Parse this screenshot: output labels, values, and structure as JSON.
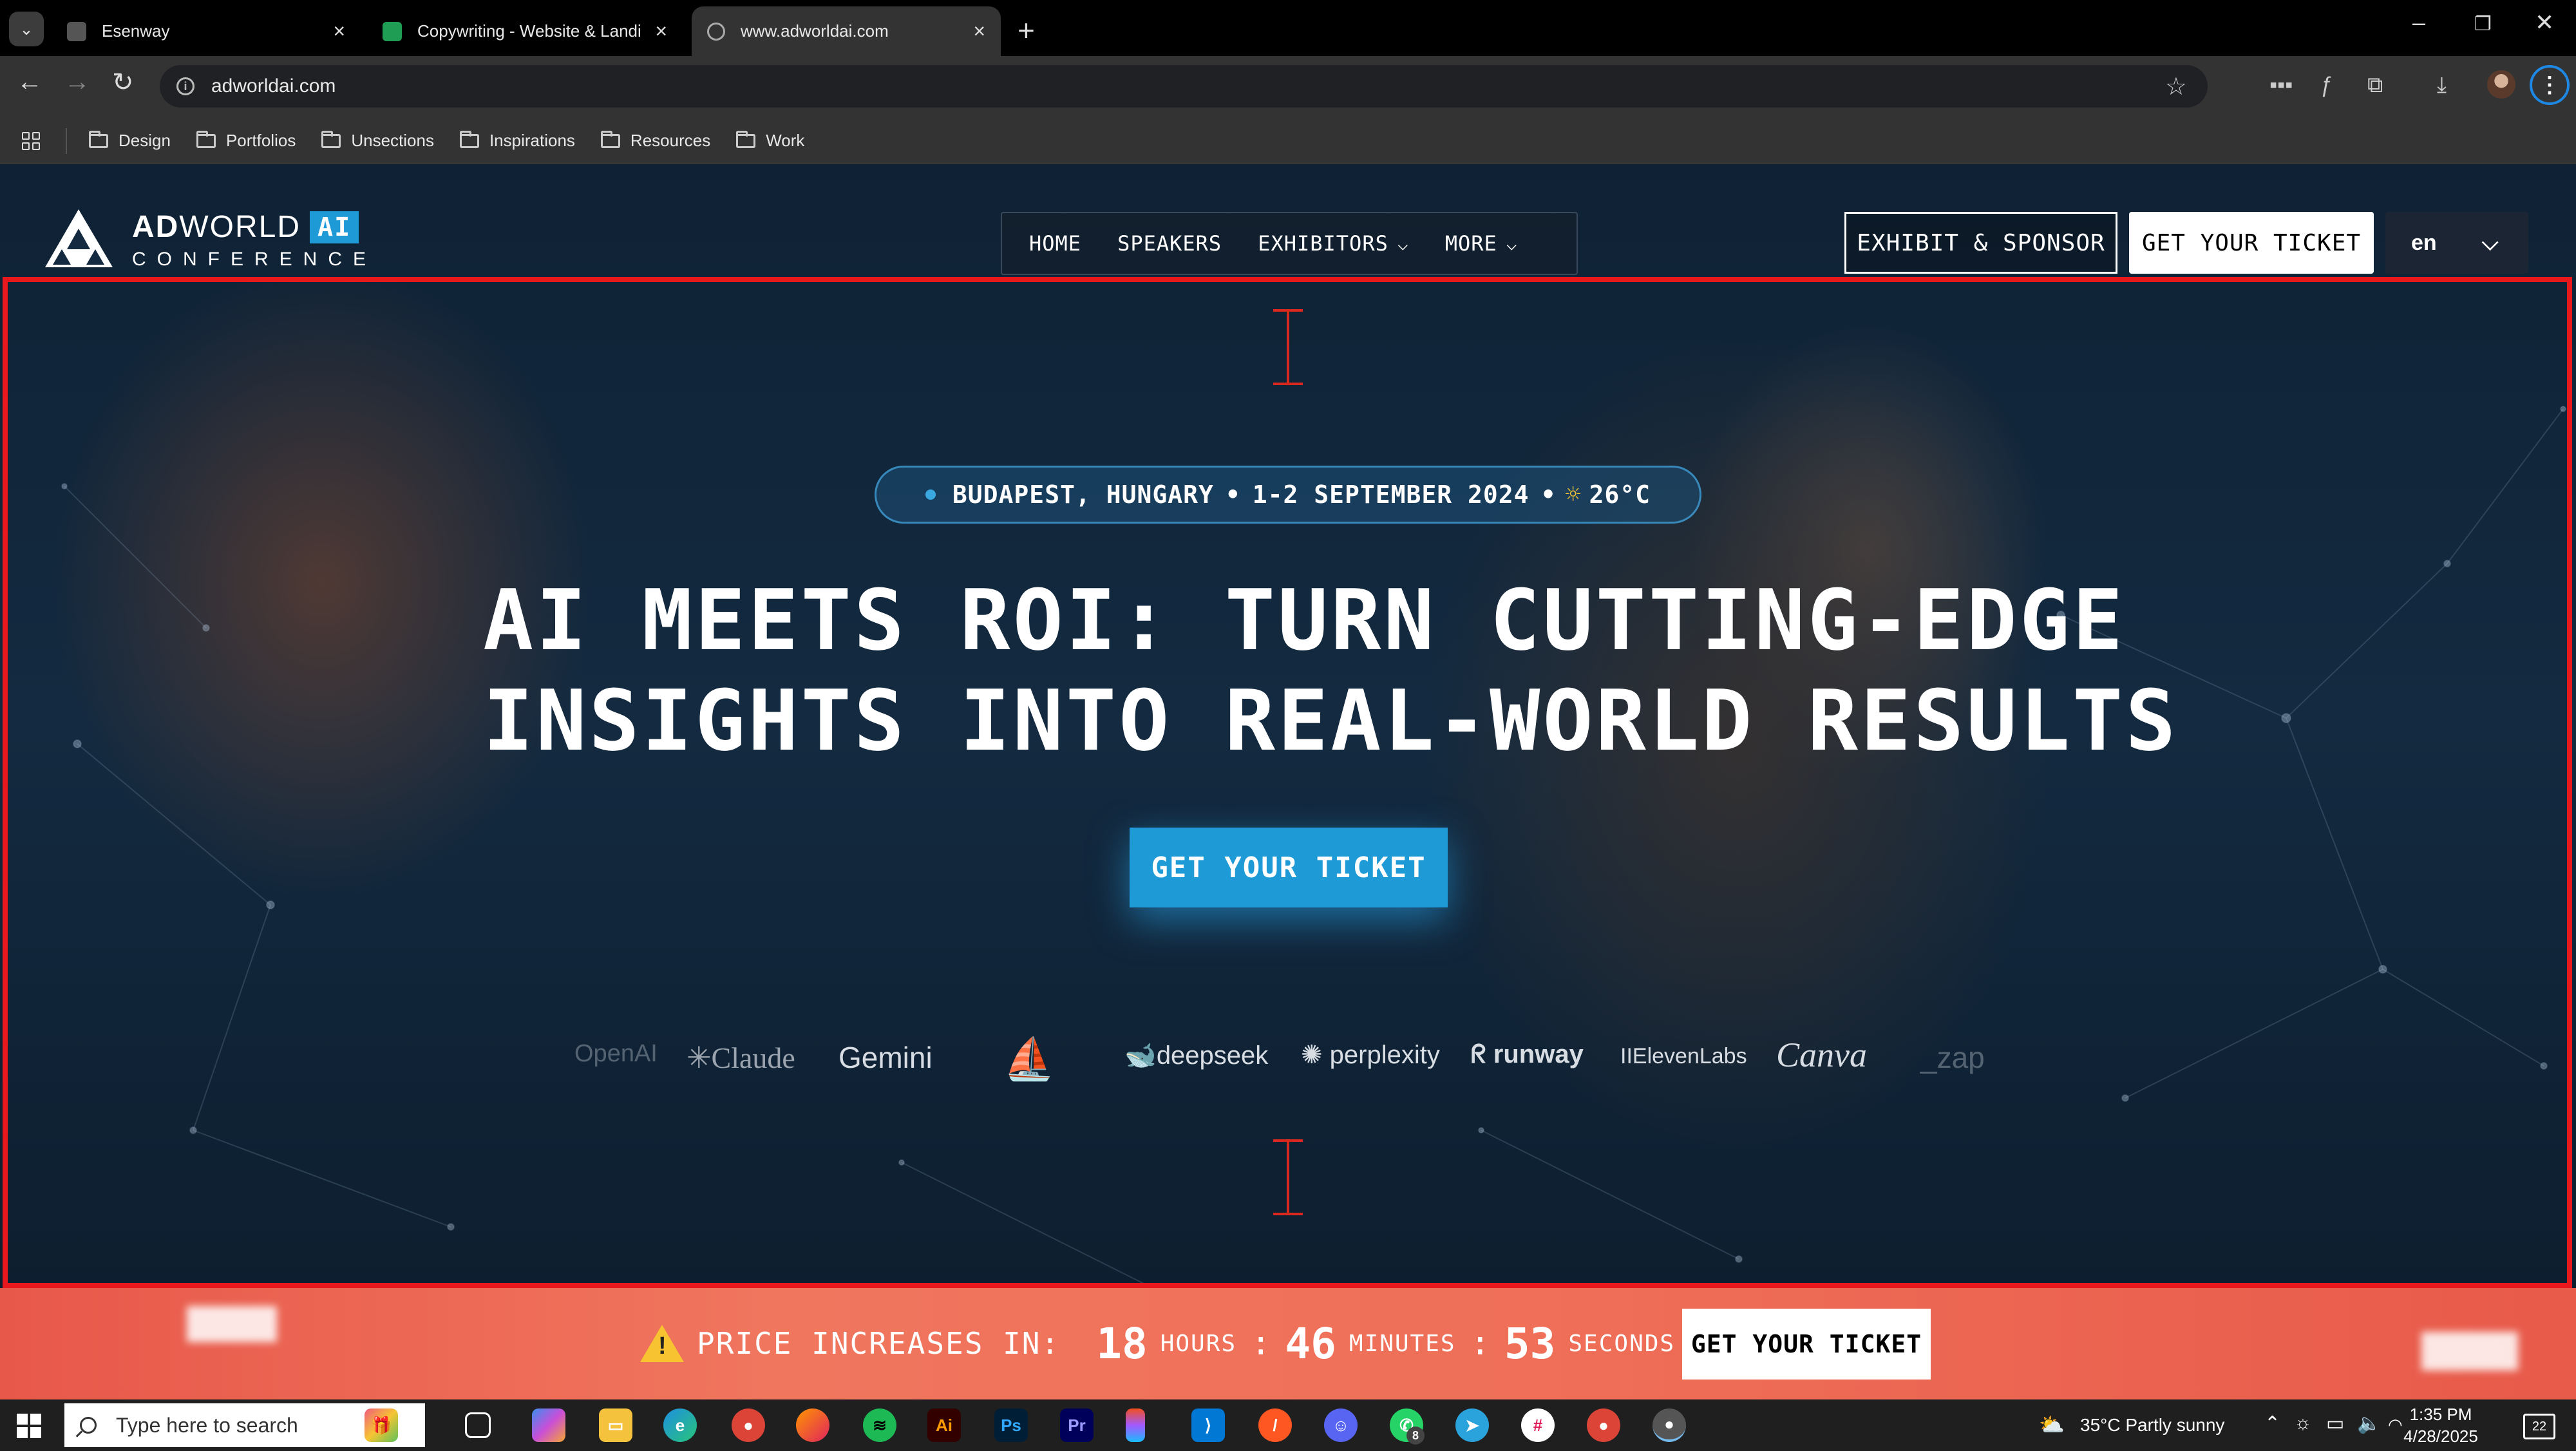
{
  "browser": {
    "tabs": [
      {
        "label": "Esenway",
        "active": false
      },
      {
        "label": "Copywriting - Website & Landi",
        "active": false
      },
      {
        "label": "www.adworldai.com",
        "active": true
      }
    ],
    "new_tab": "+",
    "address": "adworldai.com",
    "bookmarks": [
      "Design",
      "Portfolios",
      "Unsections",
      "Inspirations",
      "Resources",
      "Work"
    ],
    "window_controls": {
      "minimize": "–",
      "restore": "❐",
      "close": "✕"
    }
  },
  "site": {
    "logo": {
      "word_bold": "AD",
      "word_rest": "WORLD",
      "badge": "AI",
      "sub": "CONFERENCE"
    },
    "nav": {
      "home": "HOME",
      "speakers": "SPEAKERS",
      "exhibitors": "EXHIBITORS",
      "more": "MORE"
    },
    "exhibit_button": "EXHIBIT & SPONSOR",
    "ticket_button": "GET YOUR TICKET",
    "language": "en",
    "event_pill": {
      "location": "BUDAPEST, HUNGARY",
      "dates": "1-2 SEPTEMBER 2024",
      "separator": "•",
      "temperature": "26°C"
    },
    "headline": {
      "line1": "AI MEETS ROI: TURN CUTTING-EDGE",
      "line2": "INSIGHTS INTO REAL-WORLD RESULTS"
    },
    "cta": "GET YOUR TICKET",
    "partner_logos": [
      "OpenAI",
      "Claude",
      "Gemini",
      "Midjourney",
      "deepseek",
      "perplexity",
      "runway",
      "IIElevenLabs",
      "Canva",
      "_zap"
    ]
  },
  "price_bar": {
    "warning_icon": "!",
    "label": "PRICE INCREASES IN:",
    "hours": "18",
    "hours_unit": "HOURS",
    "minutes": "46",
    "minutes_unit": "MINUTES",
    "seconds": "53",
    "seconds_unit": "SECONDS",
    "colon": ":",
    "button": "GET YOUR TICKET"
  },
  "taskbar": {
    "search_placeholder": "Type here to search",
    "weather": "35°C  Partly sunny",
    "time": "1:35 PM",
    "date": "4/28/2025",
    "notifications": "22",
    "badges": {
      "whatsapp": "8"
    }
  },
  "colors": {
    "accent": "#1e9ad6",
    "frame": "#e8181d",
    "price_bar": "#ef6f58"
  }
}
